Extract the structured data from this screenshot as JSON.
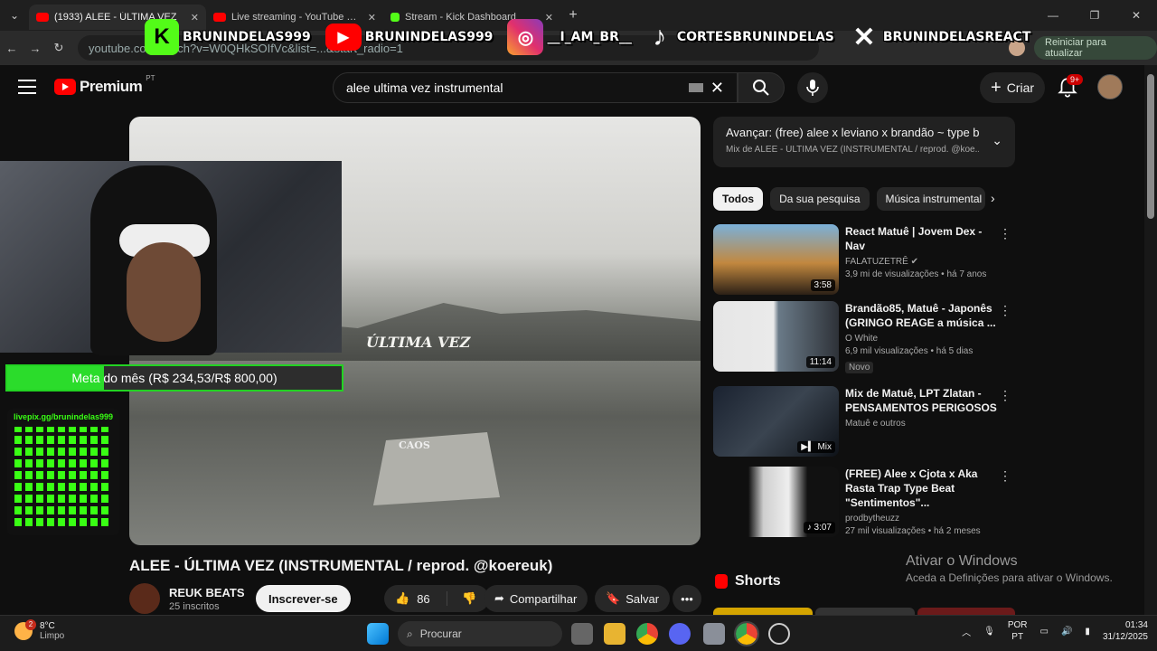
{
  "browser": {
    "tabs": [
      {
        "title": "(1933) ALEE - ÚLTIMA VEZ",
        "favicon_color": "#ff0000",
        "active": true
      },
      {
        "title": "Live streaming - YouTube Studio",
        "favicon_color": "#ff0000",
        "active": false
      },
      {
        "title": "Stream - Kick Dashboard",
        "favicon_color": "#53fc18",
        "active": false
      }
    ],
    "url": "youtube.com/watch?v=W0QHkSOIfVc&list=...&start_radio=1",
    "update_button": "Reiniciar para atualizar"
  },
  "stream_overlay": {
    "socials": [
      {
        "platform": "kick-icon",
        "handle": "BRUNINDELAS999"
      },
      {
        "platform": "youtube-icon",
        "handle": "BRUNINDELAS999"
      },
      {
        "platform": "instagram-icon",
        "handle": "__I_AM_BR__"
      },
      {
        "platform": "tiktok-icon",
        "handle": "CORTESBRUNINDELAS"
      },
      {
        "platform": "x-icon",
        "handle": "BRUNINDELASREACT"
      }
    ],
    "goal_text": "Meta do mês (R$ 234,53/R$ 800,00)",
    "goal_progress": 0.29,
    "qr_label": "livepix.gg/brunindelas999"
  },
  "youtube": {
    "logo_text": "Premium",
    "logo_region": "PT",
    "search_value": "alee ultima vez instrumental",
    "create_label": "Criar",
    "notif_badge": "9+",
    "video_text_1": "ÚLTIMA VEZ",
    "video_text_2": "CAOS",
    "video_title": "ALEE - ÚLTIMA VEZ (INSTRUMENTAL / reprod. @koereuk)",
    "channel_name": "REUK BEATS",
    "channel_subs": "25 inscritos",
    "subscribe_label": "Inscrever-se",
    "likes": "86",
    "share_label": "Compartilhar",
    "save_label": "Salvar",
    "up_next_title": "Avançar: (free) alee x leviano x brandão ~ type be...",
    "up_next_sub": "Mix de ALEE - ÚLTIMA VEZ (INSTRUMENTAL / reprod. @koe...",
    "chips": [
      "Todos",
      "Da sua pesquisa",
      "Música instrumental"
    ],
    "recommendations": [
      {
        "title": "React Matuê | Jovem Dex - Nav",
        "channel": "FALATUZETRÊ",
        "meta": "3,9 mi de visualizações • há 7 anos",
        "duration": "3:58",
        "badge": ""
      },
      {
        "title": "Brandão85, Matuê - Japonês (GRINGO REAGE a música ...",
        "channel": "O White",
        "meta": "6,9 mil visualizações • há 5 dias",
        "duration": "11:14",
        "badge": "Novo"
      },
      {
        "title": "Mix de Matuê, LPT Zlatan - PENSAMENTOS PERIGOSOS",
        "channel": "Matuê e outros",
        "meta": "",
        "duration": "Mix",
        "badge": ""
      },
      {
        "title": "(FREE) Alee x Cjota x Aka Rasta Trap Type Beat \"Sentimentos\"...",
        "channel": "prodbytheuzz",
        "meta": "27 mil visualizações • há 2 meses",
        "duration": "3:07",
        "badge": ""
      }
    ],
    "shorts_label": "Shorts"
  },
  "activation": {
    "title": "Ativar o Windows",
    "subtitle": "Aceda a Definições para ativar o Windows."
  },
  "taskbar": {
    "temp": "8°C",
    "weather": "Limpo",
    "weather_badge": "2",
    "search_placeholder": "Procurar",
    "lang1": "POR",
    "lang2": "PT",
    "time": "01:34",
    "date": "31/12/2025"
  }
}
